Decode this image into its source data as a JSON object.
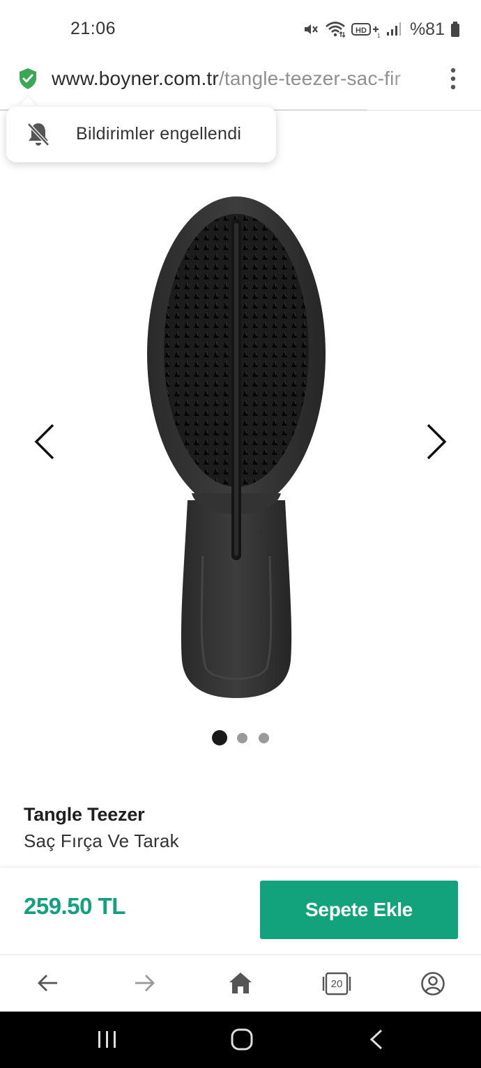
{
  "status_bar": {
    "time": "21:06",
    "battery_text": "%81",
    "icons": [
      "mute-icon",
      "wifi-icon",
      "hd-plus-icon",
      "signal-icon",
      "battery-icon"
    ],
    "hd_label": "HD+"
  },
  "browser": {
    "url_domain": "www.boyner.com.tr",
    "url_path": "/tangle-teezer-sac-fir",
    "secure_icon": "shield-check-icon",
    "menu_icon": "kebab-menu-icon",
    "tab_count": "20"
  },
  "notification": {
    "icon": "bell-off-icon",
    "text": "Bildirimler engellendi"
  },
  "carousel": {
    "image": "hairbrush-product-image",
    "dot_count": 3,
    "active_index": 0
  },
  "product": {
    "brand": "Tangle Teezer",
    "name": "Saç Fırça Ve Tarak"
  },
  "purchase": {
    "price": "259.50 TL",
    "add_to_cart_label": "Sepete Ekle"
  },
  "colors": {
    "accent_green": "#12a37d",
    "price_green": "#14a07e",
    "secure_green": "#3aa757"
  },
  "toolbar_icons": [
    "back-arrow-icon",
    "forward-arrow-icon",
    "home-icon",
    "tabs-icon",
    "profile-icon"
  ],
  "system_nav_icons": [
    "recents-icon",
    "home-circle-icon",
    "back-chevron-icon"
  ]
}
